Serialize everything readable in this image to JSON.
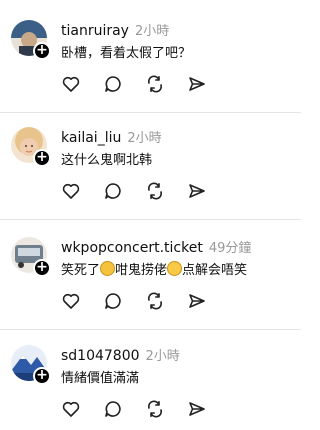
{
  "posts": [
    {
      "username": "tianruiray",
      "time": "2小時",
      "text": "卧槽，看着太假了吧？",
      "avatar_colors": [
        "#3b5f86",
        "#e8e1d5"
      ]
    },
    {
      "username": "kailai_liu",
      "time": "2小時",
      "text": "这什么鬼啊北韩",
      "avatar_colors": [
        "#e8c9a8",
        "#d48a5c"
      ]
    },
    {
      "username": "wkpopconcert.ticket",
      "time": "49分鐘",
      "text_part1": "笑死了",
      "text_part2": "咁鬼捞佬",
      "text_part3": "点解会唔笑",
      "avatar_colors": [
        "#6f7f8e",
        "#ece8e1"
      ]
    },
    {
      "username": "sd1047800",
      "time": "2小時",
      "text": "情緒價值滿滿",
      "avatar_colors": [
        "#2e5aa8",
        "#e7eef7"
      ]
    }
  ],
  "icons": {
    "like": "heart-icon",
    "reply": "comment-icon",
    "repost": "repost-icon",
    "share": "send-icon",
    "follow": "plus-icon"
  }
}
